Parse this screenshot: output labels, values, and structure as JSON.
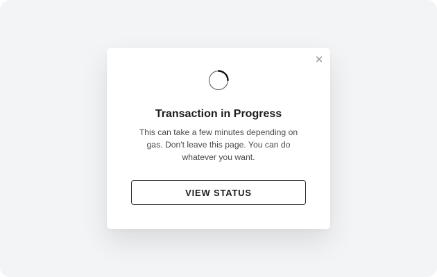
{
  "modal": {
    "close_icon": "close-icon",
    "spinner_icon": "loading-spinner-icon",
    "title": "Transaction in Progress",
    "description": "This can take a few minutes depending on gas. Don't leave this page. You can do whatever you want.",
    "button_label": "VIEW STATUS"
  },
  "colors": {
    "background": "#f3f4f6",
    "surface": "#ffffff",
    "text_primary": "#1c1c1c",
    "text_secondary": "#4a4a4a",
    "border": "#2a2a2a",
    "close_icon": "#9a9a9a"
  }
}
